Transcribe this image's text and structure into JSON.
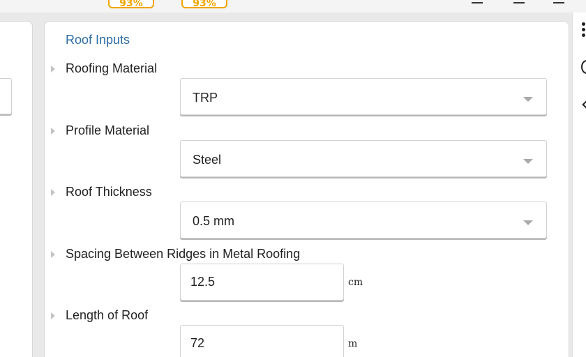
{
  "header": {
    "badges": [
      "93%",
      "93%"
    ]
  },
  "card": {
    "title": "Roof Inputs",
    "fields": [
      {
        "label": "Roofing Material",
        "type": "select",
        "value": "TRP"
      },
      {
        "label": "Profile Material",
        "type": "select",
        "value": "Steel"
      },
      {
        "label": "Roof Thickness",
        "type": "select",
        "value": "0.5 mm"
      },
      {
        "label": "Spacing Between Ridges in Metal Roofing",
        "type": "input",
        "value": "12.5",
        "unit": "cm"
      },
      {
        "label": "Length of Roof",
        "type": "input",
        "value": "72",
        "unit": "m"
      }
    ]
  },
  "icons": {
    "right_toolbar": [
      "more-vertical-icon",
      "info-ring-icon",
      "chevron-left-icon"
    ],
    "field_toggle": "caret-right-icon",
    "select_arrow": "chevron-down-icon"
  },
  "colors": {
    "title": "#2e6da4",
    "badge": "#f0a500"
  }
}
